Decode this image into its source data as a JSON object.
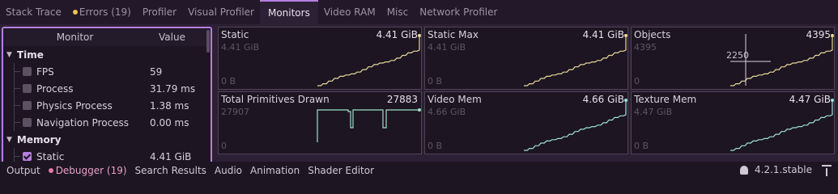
{
  "tabs": [
    {
      "label": "Stack Trace",
      "dot": null,
      "active": false
    },
    {
      "label": "Errors (19)",
      "dot": "#f0c44a",
      "active": false
    },
    {
      "label": "Profiler",
      "dot": null,
      "active": false
    },
    {
      "label": "Visual Profiler",
      "dot": null,
      "active": false
    },
    {
      "label": "Monitors",
      "dot": null,
      "active": true
    },
    {
      "label": "Video RAM",
      "dot": null,
      "active": false
    },
    {
      "label": "Misc",
      "dot": null,
      "active": false
    },
    {
      "label": "Network Profiler",
      "dot": null,
      "active": false
    }
  ],
  "tree": {
    "header": {
      "monitor": "Monitor",
      "value": "Value"
    },
    "groups": [
      {
        "label": "Time",
        "items": [
          {
            "label": "FPS",
            "value": "59",
            "checked": false
          },
          {
            "label": "Process",
            "value": "31.79 ms",
            "checked": false
          },
          {
            "label": "Physics Process",
            "value": "1.38 ms",
            "checked": false
          },
          {
            "label": "Navigation Process",
            "value": "0.00 ms",
            "checked": false
          }
        ]
      },
      {
        "label": "Memory",
        "items": [
          {
            "label": "Static",
            "value": "4.41 GiB",
            "checked": true
          }
        ]
      }
    ]
  },
  "graphs": [
    {
      "title": "Static",
      "value": "4.41 GiB",
      "max": "4.41 GiB",
      "min": "0 B",
      "color": "#e8d89a",
      "shape": "stairs"
    },
    {
      "title": "Static Max",
      "value": "4.41 GiB",
      "max": "4.41 GiB",
      "min": "0 B",
      "color": "#e8d89a",
      "shape": "stairs"
    },
    {
      "title": "Objects",
      "value": "4395",
      "max": "4395",
      "min": "0",
      "mid": "2250",
      "color": "#e8d89a",
      "shape": "stairs-cursor"
    },
    {
      "title": "Total Primitives Drawn",
      "value": "27883",
      "max": "27907",
      "min": "0",
      "color": "#9fe0c4",
      "shape": "primitives"
    },
    {
      "title": "Video Mem",
      "value": "4.66 GiB",
      "max": "4.66 GiB",
      "min": "0 B",
      "color": "#9fe0d8",
      "shape": "stairs"
    },
    {
      "title": "Texture Mem",
      "value": "4.47 GiB",
      "max": "4.47 GiB",
      "min": "0 B",
      "color": "#9fe0d8",
      "shape": "stairs"
    }
  ],
  "bottom": {
    "tabs": [
      {
        "label": "Output",
        "dot": null,
        "active": false
      },
      {
        "label": "Debugger (19)",
        "dot": "#e37aa8",
        "active": true
      },
      {
        "label": "Search Results",
        "dot": null,
        "active": false
      },
      {
        "label": "Audio",
        "dot": null,
        "active": false
      },
      {
        "label": "Animation",
        "dot": null,
        "active": false
      },
      {
        "label": "Shader Editor",
        "dot": null,
        "active": false
      }
    ],
    "version": "4.2.1.stable"
  }
}
